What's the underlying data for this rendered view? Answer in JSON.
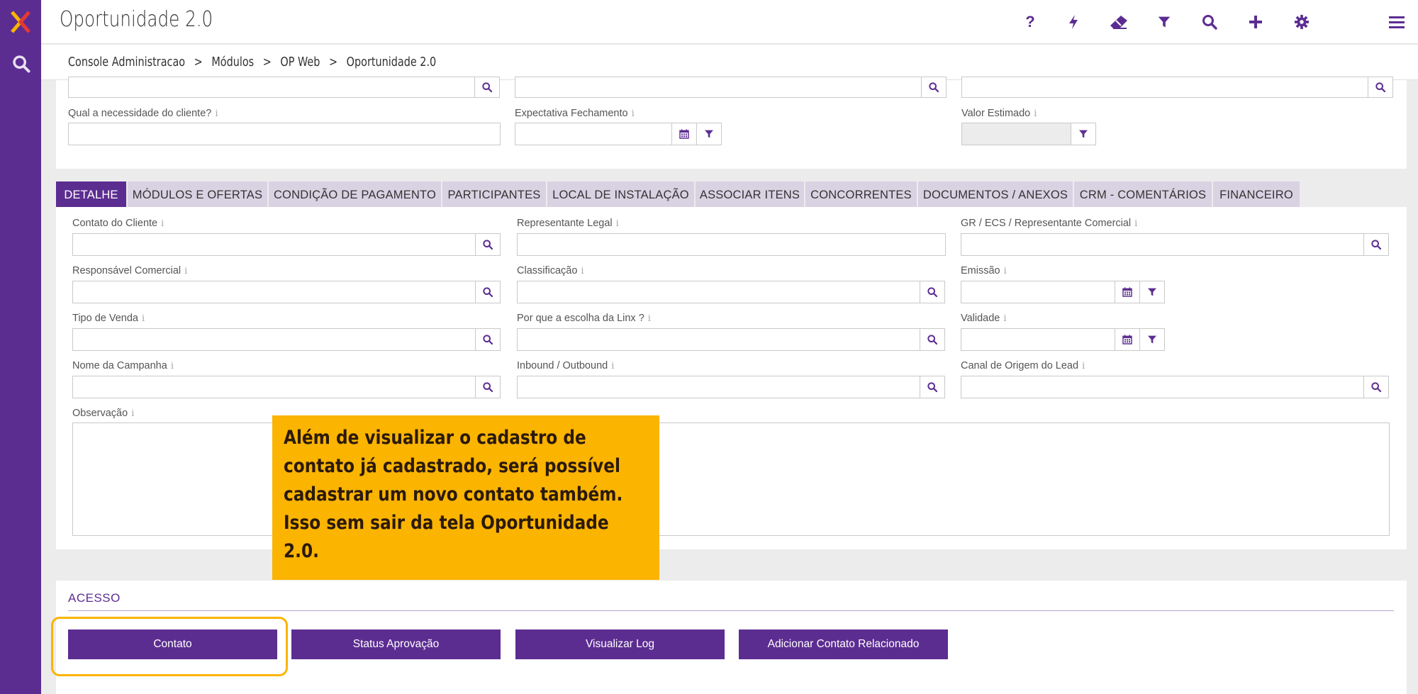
{
  "header": {
    "title": "Oportunidade 2.0",
    "icons": [
      "help-icon",
      "bolt-icon",
      "eraser-icon",
      "filter-icon",
      "search-icon",
      "plus-icon",
      "gear-icon",
      "menu-icon"
    ],
    "help_glyph": "?"
  },
  "breadcrumb": [
    "Console Administracao",
    ">",
    "Módulos",
    ">",
    "OP Web",
    ">",
    "Oportunidade 2.0"
  ],
  "top_fields": {
    "necessidade": "Qual a necessidade do cliente?",
    "expectativa": "Expectativa Fechamento",
    "valor": "Valor Estimado"
  },
  "info_glyph": "i",
  "tabs": [
    "DETALHE",
    "MÓDULOS E OFERTAS",
    "CONDIÇÃO DE PAGAMENTO",
    "PARTICIPANTES",
    "LOCAL DE INSTALAÇÃO",
    "ASSOCIAR ITENS",
    "CONCORRENTES",
    "DOCUMENTOS / ANEXOS",
    "CRM - COMENTÁRIOS",
    "FINANCEIRO"
  ],
  "detail_fields": {
    "contato": "Contato do Cliente",
    "representante": "Representante Legal",
    "gr": "GR / ECS / Representante Comercial",
    "responsavel": "Responsável Comercial",
    "classificacao": "Classificação",
    "emissao": "Emissão",
    "tipo_venda": "Tipo de Venda",
    "escolha": "Por que a escolha da Linx ?",
    "validade": "Validade",
    "campanha": "Nome da Campanha",
    "inbound": "Inbound / Outbound",
    "canal": "Canal de Origem do Lead",
    "observacao": "Observação"
  },
  "callout": {
    "text": "Além de visualizar o cadastro de contato já cadastrado, será possível cadastrar um novo contato também. Isso sem sair da tela Oportunidade 2.0."
  },
  "access": {
    "title": "ACESSO",
    "buttons": [
      "Contato",
      "Status Aprovação",
      "Visualizar Log",
      "Adicionar Contato Relacionado"
    ]
  },
  "colors": {
    "brand_purple": "#5c2d91",
    "tab_inactive": "#d9d2e3",
    "callout_yellow": "#fbb400"
  }
}
